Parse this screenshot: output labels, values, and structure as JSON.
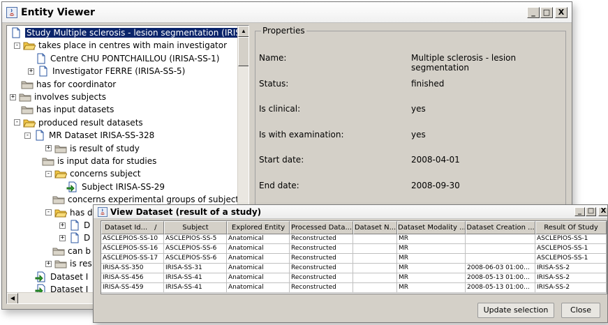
{
  "window": {
    "title": "Entity Viewer",
    "buttons": {
      "minimize": "_",
      "maximize": "□",
      "close": "X"
    }
  },
  "tree": {
    "nodes": [
      {
        "label": "Study Multiple sclerosis - lesion segmentation (IRISA-S",
        "icon": "document-icon",
        "expander": ""
      },
      {
        "label": "takes place in centres with main investigator",
        "icon": "folder-open-icon",
        "expander": "-"
      },
      {
        "label": "Centre CHU PONTCHAILLOU (IRISA-SS-1)",
        "icon": "document-icon",
        "expander": ""
      },
      {
        "label": "Investigator FERRE (IRISA-SS-5)",
        "icon": "document-icon",
        "expander": "+"
      },
      {
        "label": "has for coordinator",
        "icon": "folder-closed-icon",
        "expander": ""
      },
      {
        "label": "involves subjects",
        "icon": "folder-closed-icon",
        "expander": "+"
      },
      {
        "label": "has input datasets",
        "icon": "folder-closed-icon",
        "expander": ""
      },
      {
        "label": "produced result datasets",
        "icon": "folder-open-icon",
        "expander": "-"
      },
      {
        "label": "MR Dataset IRISA-SS-328",
        "icon": "document-icon",
        "expander": "-"
      },
      {
        "label": "is result of study",
        "icon": "folder-closed-icon",
        "expander": "+"
      },
      {
        "label": "is input data for studies",
        "icon": "folder-closed-icon",
        "expander": ""
      },
      {
        "label": "concerns subject",
        "icon": "folder-open-icon",
        "expander": "-"
      },
      {
        "label": "Subject IRISA-SS-29",
        "icon": "link-icon",
        "expander": ""
      },
      {
        "label": "concerns experimental groups of subjects",
        "icon": "folder-closed-icon",
        "expander": ""
      },
      {
        "label": "has d",
        "icon": "folder-open-icon",
        "expander": "-"
      },
      {
        "label": "D",
        "icon": "document-icon",
        "expander": "+"
      },
      {
        "label": "D",
        "icon": "document-icon",
        "expander": "+"
      },
      {
        "label": "can b",
        "icon": "folder-closed-icon",
        "expander": ""
      },
      {
        "label": "is res",
        "icon": "folder-closed-icon",
        "expander": "+"
      },
      {
        "label": "Dataset I",
        "icon": "link-icon",
        "expander": ""
      },
      {
        "label": "Dataset I",
        "icon": "link-icon",
        "expander": ""
      }
    ]
  },
  "properties": {
    "legend": "Properties",
    "rows": [
      {
        "key": "Name:",
        "value": "Multiple sclerosis - lesion segmentation"
      },
      {
        "key": "Status:",
        "value": "finished"
      },
      {
        "key": "Is clinical:",
        "value": "yes"
      },
      {
        "key": "Is with examination:",
        "value": "yes"
      },
      {
        "key": "Start date:",
        "value": "2008-04-01"
      },
      {
        "key": "End date:",
        "value": "2008-09-30"
      }
    ]
  },
  "dialog": {
    "title": "View Dataset (result of a study)",
    "buttons": {
      "minimize": "_",
      "maximize": "□",
      "close": "X"
    },
    "columns": [
      "Dataset Id...",
      "Subject",
      "Explored Entity",
      "Processed Data...",
      "Dataset N...",
      "Dataset Modality ...",
      "Dataset Creation ...",
      "Result Of Study"
    ],
    "rows": [
      [
        "ASCLEPIOS-SS-10",
        "ASCLEPIOS-SS-5",
        "Anatomical",
        "Reconstructed",
        "",
        "MR",
        "",
        "ASCLEPIOS-SS-1"
      ],
      [
        "ASCLEPIOS-SS-16",
        "ASCLEPIOS-SS-6",
        "Anatomical",
        "Reconstructed",
        "",
        "MR",
        "",
        "ASCLEPIOS-SS-1"
      ],
      [
        "ASCLEPIOS-SS-17",
        "ASCLEPIOS-SS-6",
        "Anatomical",
        "Reconstructed",
        "",
        "MR",
        "",
        "ASCLEPIOS-SS-1"
      ],
      [
        "IRISA-SS-350",
        "IRISA-SS-31",
        "Anatomical",
        "Reconstructed",
        "",
        "MR",
        "2008-06-03 01:00...",
        "IRISA-SS-2"
      ],
      [
        "IRISA-SS-456",
        "IRISA-SS-41",
        "Anatomical",
        "Reconstructed",
        "",
        "MR",
        "2008-05-13 01:00...",
        "IRISA-SS-2"
      ],
      [
        "IRISA-SS-459",
        "IRISA-SS-41",
        "Anatomical",
        "Reconstructed",
        "",
        "MR",
        "2008-05-13 01:00...",
        "IRISA-SS-2"
      ]
    ],
    "sort_indicator": "/",
    "update_button": "Update selection",
    "close_button": "Close"
  },
  "colors": {
    "selection": "#0a246a",
    "folder": "#f2c744",
    "link_arrow": "#2e9e2e"
  }
}
